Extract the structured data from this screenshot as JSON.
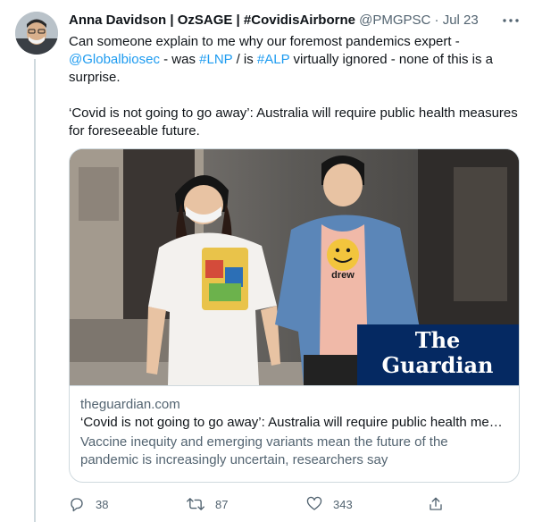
{
  "tweet": {
    "author": {
      "display_name": "Anna Davidson | OzSAGE | #CovidisAirborne",
      "handle": "@PMGPSC",
      "separator": "·",
      "date": "Jul 23",
      "avatar": "avatar-photo"
    },
    "text": {
      "seg1": "Can someone explain to me why our foremost pandemics expert - ",
      "mention": "@Globalbiosec",
      "seg2": " - was ",
      "hashtag1": "#LNP",
      "seg3": " / is ",
      "hashtag2": "#ALP",
      "seg4": " virtually ignored - none of this is a surprise.",
      "quote": "‘Covid is not going to go away’: Australia will require public health measures for foreseeable future."
    },
    "link_card": {
      "image_logo_line1": "The",
      "image_logo_line2": "Guardian",
      "shirt_badge_text": "drew",
      "domain": "theguardian.com",
      "title": "‘Covid is not going to go away’: Australia will require public health measures for foreseeable future",
      "description": "Vaccine inequity and emerging variants mean the future of the pandemic is increasingly uncertain, researchers say"
    },
    "actions": {
      "reply_count": "38",
      "retweet_count": "87",
      "like_count": "343"
    },
    "icons": [
      "more-icon",
      "reply-icon",
      "retweet-icon",
      "like-icon",
      "share-icon"
    ],
    "colors": {
      "link": "#1d9bf0",
      "secondary_text": "#536471",
      "border": "#cfd9de",
      "guardian_blue": "#052962"
    }
  }
}
